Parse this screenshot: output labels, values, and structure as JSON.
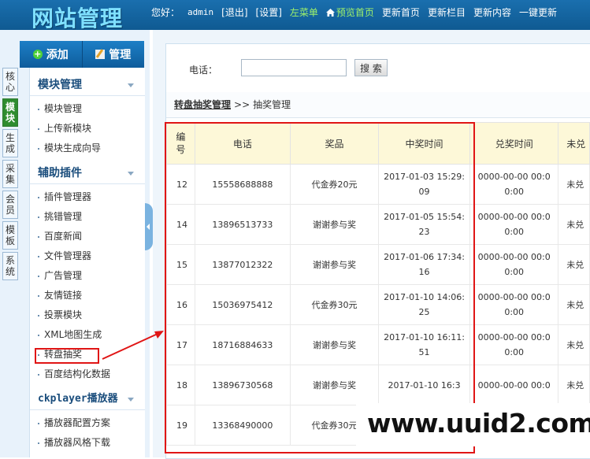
{
  "header": {
    "logo_text": "网站管理",
    "greeting": "您好：",
    "username": "admin",
    "logout": "[退出]",
    "settings": "[设置]",
    "left_menu": "左菜单",
    "preview_home": "预览首页",
    "update_home": "更新首页",
    "update_columns": "更新栏目",
    "update_content": "更新内容",
    "one_click_update": "一键更新"
  },
  "side_header": {
    "add_label": "添加",
    "manage_label": "管理"
  },
  "vertical_tabs": [
    "核心",
    "模块",
    "生成",
    "采集",
    "会员",
    "模板",
    "系统"
  ],
  "active_tab": "模块",
  "sections": [
    {
      "title": "模块管理",
      "items": [
        "模块管理",
        "上传新模块",
        "模块生成向导"
      ]
    },
    {
      "title": "辅助插件",
      "items": [
        "插件管理器",
        "挑错管理",
        "百度新闻",
        "文件管理器",
        "广告管理",
        "友情链接",
        "投票模块",
        "XML地图生成",
        "转盘抽奖",
        "百度结构化数据"
      ]
    },
    {
      "title": "ckplayer播放器",
      "items": [
        "播放器配置方案",
        "播放器风格下载"
      ]
    }
  ],
  "highlighted_item": "转盘抽奖",
  "search": {
    "label": "电话：",
    "value": "",
    "placeholder": "",
    "button": "搜 索"
  },
  "breadcrumb": {
    "parent": "转盘抽奖管理",
    "separator": ">>",
    "current": "抽奖管理"
  },
  "table": {
    "headers": [
      "编号",
      "电话",
      "奖品",
      "中奖时间",
      "兑奖时间",
      "未兑"
    ],
    "rows": [
      {
        "id": "12",
        "phone": "15558688888",
        "prize": "代金券20元",
        "win_time": "2017-01-03 15:29:09",
        "redeem_time": "0000-00-00 00:00:00",
        "status": "未兑"
      },
      {
        "id": "14",
        "phone": "13896513733",
        "prize": "谢谢参与奖",
        "win_time": "2017-01-05 15:54:23",
        "redeem_time": "0000-00-00 00:00:00",
        "status": "未兑"
      },
      {
        "id": "15",
        "phone": "13877012322",
        "prize": "谢谢参与奖",
        "win_time": "2017-01-06 17:34:16",
        "redeem_time": "0000-00-00 00:00:00",
        "status": "未兑"
      },
      {
        "id": "16",
        "phone": "15036975412",
        "prize": "代金券30元",
        "win_time": "2017-01-10 14:06:25",
        "redeem_time": "0000-00-00 00:00:00",
        "status": "未兑"
      },
      {
        "id": "17",
        "phone": "18716884633",
        "prize": "谢谢参与奖",
        "win_time": "2017-01-10 16:11:51",
        "redeem_time": "0000-00-00 00:00:00",
        "status": "未兑"
      },
      {
        "id": "18",
        "phone": "13896730568",
        "prize": "谢谢参与奖",
        "win_time": "2017-01-10 16:3",
        "redeem_time": "0000-00-00 00:0",
        "status": "未兑"
      },
      {
        "id": "19",
        "phone": "13368490000",
        "prize": "代金券30元",
        "win_time": "",
        "redeem_time": "",
        "status": ""
      }
    ]
  },
  "watermark": "www.uuid2.com",
  "colors": {
    "header_blue": "#1a6fae",
    "highlight_red": "#e01515",
    "active_tab_green": "#2f8c2f",
    "table_header_bg": "#fdf8d8"
  }
}
